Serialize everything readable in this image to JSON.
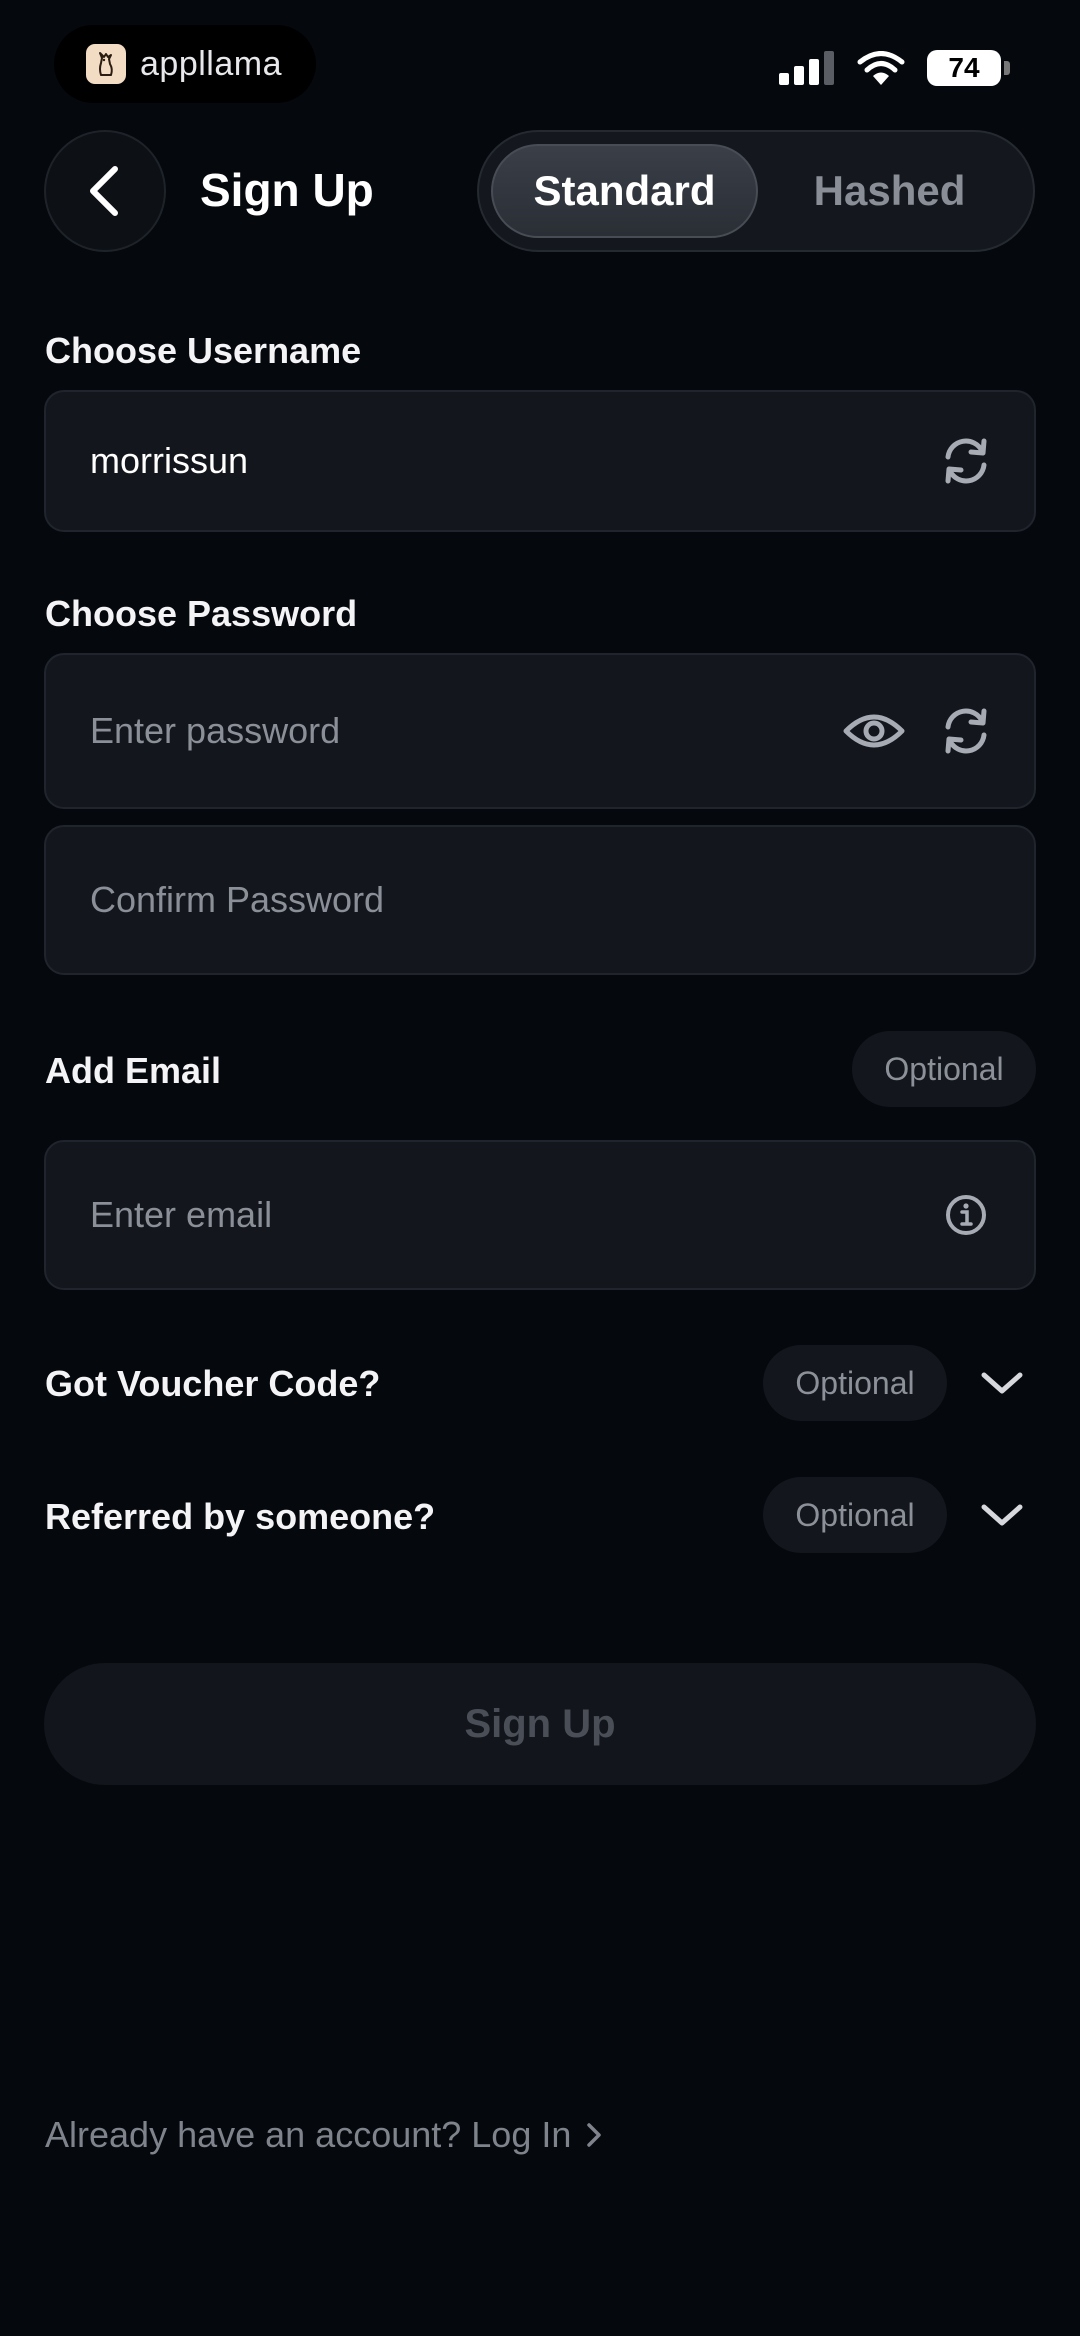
{
  "status_bar": {
    "app_name": "appllama",
    "battery": "74"
  },
  "header": {
    "title": "Sign Up",
    "tabs": [
      {
        "label": "Standard",
        "active": true
      },
      {
        "label": "Hashed",
        "active": false
      }
    ]
  },
  "form": {
    "username": {
      "label": "Choose Username",
      "value": "morrissun"
    },
    "password": {
      "label": "Choose Password",
      "placeholder": "Enter password",
      "confirm_placeholder": "Confirm Password"
    },
    "email": {
      "label": "Add Email",
      "optional": "Optional",
      "placeholder": "Enter email"
    },
    "voucher": {
      "label": "Got Voucher Code?",
      "optional": "Optional"
    },
    "referral": {
      "label": "Referred by someone?",
      "optional": "Optional"
    },
    "submit_label": "Sign Up"
  },
  "footer": {
    "login_text": "Already have an account? Log In"
  },
  "colors": {
    "background": "#05080d",
    "field_bg": "#13161d",
    "muted_text": "#8b8f97"
  }
}
